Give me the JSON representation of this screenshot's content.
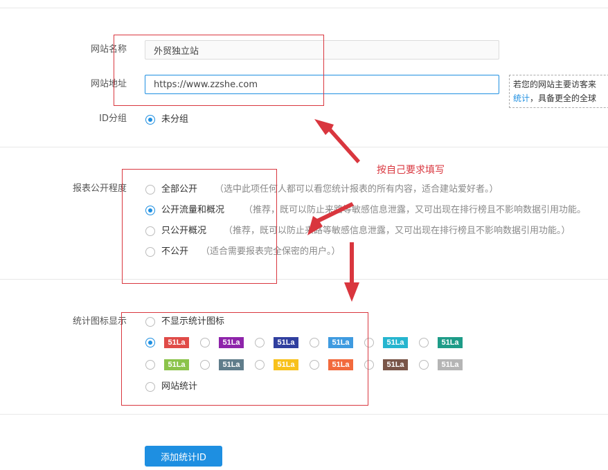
{
  "form": {
    "site_name": {
      "label": "网站名称",
      "value": "外贸独立站"
    },
    "site_url": {
      "label": "网站地址",
      "value": "https://www.zzshe.com"
    },
    "tip": {
      "line1": "若您的网站主要访客来",
      "line2_link": "统计",
      "line2_rest": "，具备更全的全球"
    },
    "id_group": {
      "label": "ID分组",
      "option": "未分组"
    },
    "report_visibility": {
      "label": "报表公开程度",
      "options": [
        {
          "label": "全部公开",
          "note": "（选中此项任何人都可以看您统计报表的所有内容，适合建站爱好者。）",
          "checked": false
        },
        {
          "label": "公开流量和概况",
          "note": "（推荐，既可以防止来路等敏感信息泄露，又可出现在排行榜且不影响数据引用功能。",
          "checked": true
        },
        {
          "label": "只公开概况",
          "note": "（推荐，既可以防止来路等敏感信息泄露，又可出现在排行榜且不影响数据引用功能。）",
          "checked": false
        },
        {
          "label": "不公开",
          "note": "（适合需要报表完全保密的用户。）",
          "checked": false
        }
      ]
    },
    "stat_icon": {
      "label": "统计图标显示",
      "none_option": "不显示统计图标",
      "badge_text": "51La",
      "badge_colors_row1": [
        "#e04b48",
        "#8e24aa",
        "#303f9f",
        "#3f9be0",
        "#26b5cf",
        "#1e9c88"
      ],
      "badge_colors_row2": [
        "#8bc34a",
        "#607d8b",
        "#f8c11b",
        "#f26a3d",
        "#795548",
        "#b5b5b5"
      ],
      "selected_badge_index": 0,
      "site_stat_option": "网站统计"
    },
    "submit_label": "添加统计ID"
  },
  "annotation": {
    "text": "按自己要求填写",
    "color": "#d9363e"
  },
  "colors": {
    "accent": "#1e8fe1",
    "annotation_red": "#d9363e"
  }
}
